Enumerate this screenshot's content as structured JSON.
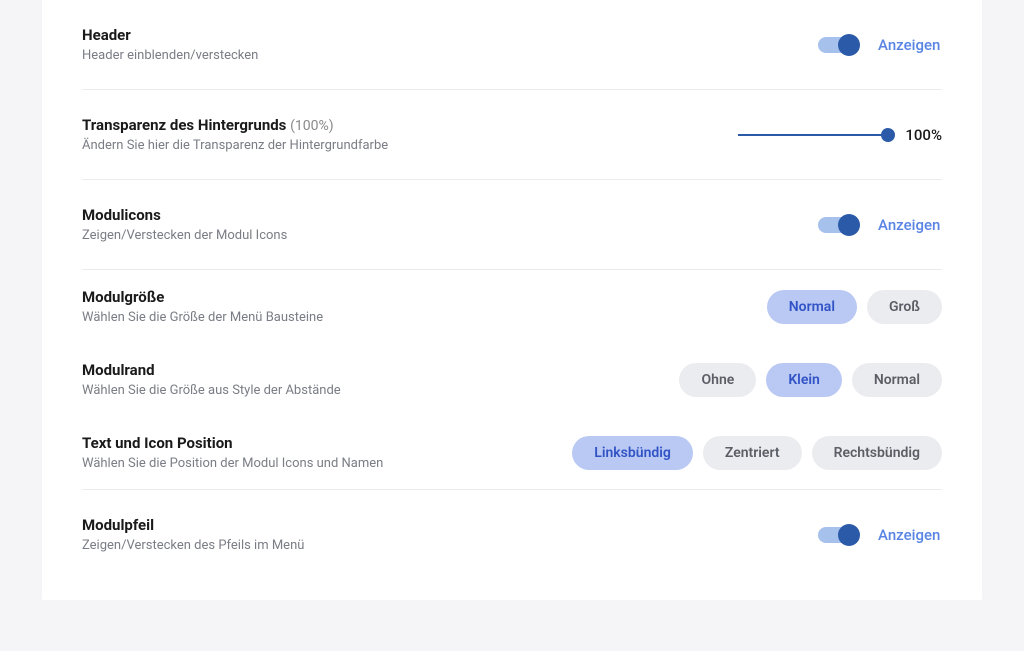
{
  "commonToggleLabel": "Anzeigen",
  "rows": {
    "header": {
      "title": "Header",
      "subtitle": "Header einblenden/verstecken",
      "toggle": {
        "on": true
      }
    },
    "transparency": {
      "title": "Transparenz des Hintergrunds",
      "suffix": "(100%)",
      "subtitle": "Ändern Sie hier die Transparenz der Hintergrundfarbe",
      "slider": {
        "percent": 100,
        "displayValue": "100%"
      }
    },
    "modulicons": {
      "title": "Modulicons",
      "subtitle": "Zeigen/Verstecken der Modul Icons",
      "toggle": {
        "on": true
      }
    },
    "modulsize": {
      "title": "Modulgröße",
      "subtitle": "Wählen Sie die Größe der Menü Bausteine",
      "options": {
        "normal": "Normal",
        "gross": "Groß"
      },
      "selected": "normal"
    },
    "modulrand": {
      "title": "Modulrand",
      "subtitle": "Wählen Sie die Größe aus Style der Abstände",
      "options": {
        "ohne": "Ohne",
        "klein": "Klein",
        "normal": "Normal"
      },
      "selected": "klein"
    },
    "textpos": {
      "title": "Text und Icon Position",
      "subtitle": "Wählen Sie die Position der Modul Icons und Namen",
      "options": {
        "links": "Linksbündig",
        "zentriert": "Zentriert",
        "rechts": "Rechtsbündig"
      },
      "selected": "links"
    },
    "modulpfeil": {
      "title": "Modulpfeil",
      "subtitle": "Zeigen/Verstecken des Pfeils im Menü",
      "toggle": {
        "on": true
      }
    }
  }
}
